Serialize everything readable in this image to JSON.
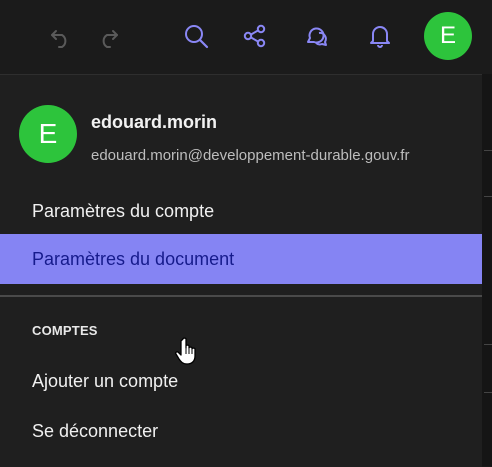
{
  "toolbar": {
    "icons": [
      "undo-icon",
      "redo-icon",
      "search-icon",
      "share-icon",
      "comments-icon",
      "notifications-bell-icon"
    ],
    "avatar_letter": "E",
    "colors": {
      "accent": "#8a87f5",
      "disabled": "#5a5a5a",
      "avatar": "#2dc43c"
    }
  },
  "account_menu": {
    "user": {
      "avatar_letter": "E",
      "name": "edouard.morin",
      "email": "edouard.morin@developpement-durable.gouv.fr"
    },
    "items": [
      {
        "label": "Paramètres du compte",
        "highlighted": false
      },
      {
        "label": "Paramètres du document",
        "highlighted": true
      }
    ],
    "section_label": "COMPTES",
    "account_actions": [
      {
        "label": "Ajouter un compte"
      },
      {
        "label": "Se déconnecter"
      }
    ],
    "colors": {
      "highlight_bg": "#8584f3",
      "highlight_text": "#161b8c"
    }
  }
}
